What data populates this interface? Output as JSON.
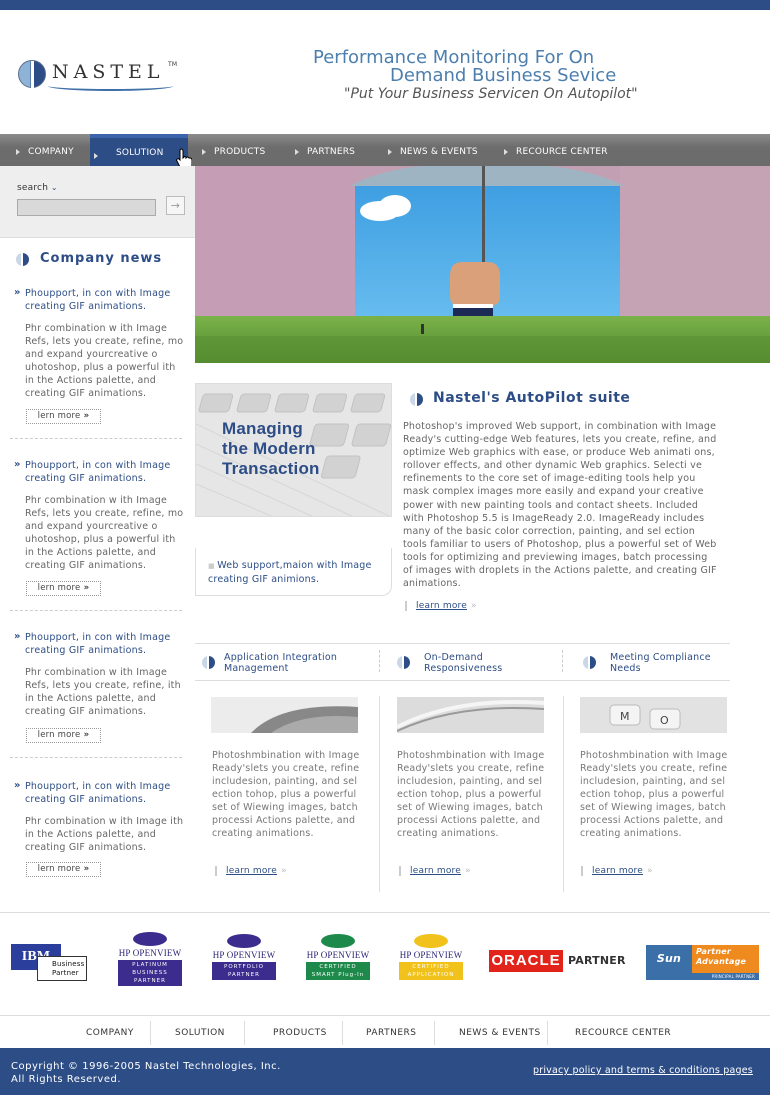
{
  "header": {
    "logo_text": "NASTEL",
    "logo_tm": "TM",
    "tagline_line1": "Performance Monitoring For  On",
    "tagline_line2": "Demand Business Sevice",
    "tagline_quote": "\"Put Your Business Servicen On Autopilot\""
  },
  "nav": {
    "items": [
      {
        "label": "COMPANY"
      },
      {
        "label": "SOLUTION"
      },
      {
        "label": "PRODUCTS"
      },
      {
        "label": "PARTNERS"
      },
      {
        "label": "NEWS & EVENTS"
      },
      {
        "label": "RECOURCE CENTER"
      }
    ],
    "active": "SOLUTION"
  },
  "search": {
    "label": "search",
    "placeholder": "",
    "go_icon": "arrow-right-icon"
  },
  "company_news": {
    "title": "Company news",
    "items": [
      {
        "headline": "Phoupport, in con with Image creating GIF animations.",
        "body": "Phr combination w ith Image Refs, lets you create, refine, mo and expand yourcreative o uhotoshop, plus a powerful ith in the Actions palette, and creating GIF animations.",
        "link": "lern more"
      },
      {
        "headline": "Phoupport, in con with Image creating GIF animations.",
        "body": "Phr combination w ith Image Refs, lets you create, refine, mo and expand yourcreative o uhotoshop, plus a powerful ith in the Actions palette, and creating GIF animations.",
        "link": "lern more"
      },
      {
        "headline": "Phoupport, in con with Image creating GIF animations.",
        "body": "Phr combination w ith Image Refs, lets you create, refine, ith in the Actions palette, and creating GIF animations.",
        "link": "lern more"
      },
      {
        "headline": "Phoupport, in con with Image creating GIF animations.",
        "body": "Phr combination w ith Image ith in the Actions palette, and creating GIF animations.",
        "link": "lern more"
      }
    ]
  },
  "feature": {
    "image_title_line1": "Managing",
    "image_title_line2": "the Modern",
    "image_title_line3": "Transaction",
    "callout": "Web support,maion with Image creating GIF animions."
  },
  "suite": {
    "title": "Nastel's AutoPilot suite",
    "body": "Photoshop's improved Web support, in combination with Image Ready's cutting-edge Web features, lets you create, refine, and optimize Web graphics with ease, or produce Web animati ons, rollover effects, and other dynamic Web graphics. Selecti ve refinements to the core set of image-editing tools help you mask complex images more easily and expand your creative power with new painting tools and contact sheets. Included with Photoshop 5.5 is ImageReady 2.0. ImageReady includes many of the basic color correction, painting, and sel ection tools familiar to users of Photoshop, plus a powerful set of Web tools for optimizing and previewing images, batch processing of images with droplets in the Actions palette, and creating GIF animations.",
    "link": "learn more"
  },
  "columns": [
    {
      "title_line1": "Application Integration",
      "title_line2": "Management",
      "body": "Photoshmbination with Image Ready'slets you create, refine includesion, painting, and sel ection tohop, plus a powerful set of Wiewing images, batch processi Actions palette, and creating animations.",
      "link": "learn more"
    },
    {
      "title_line1": "On-Demand",
      "title_line2": "Responsiveness",
      "body": "Photoshmbination with Image Ready'slets you create, refine includesion, painting, and sel ection tohop, plus a powerful set of Wiewing images, batch processi Actions palette, and creating animations.",
      "link": "learn more"
    },
    {
      "title_line1": "Meeting Compliance",
      "title_line2": "Needs",
      "body": "Photoshmbination with Image Ready'slets you create, refine includesion, painting, and sel ection tohop, plus a powerful set of Wiewing images, batch processi Actions palette, and creating animations.",
      "link": "learn more"
    }
  ],
  "partners": [
    {
      "name": "IBM",
      "sub": "Business Partner"
    },
    {
      "name": "HP OPENVIEW",
      "sub": "PLATINUM BUSINESS PARTNER"
    },
    {
      "name": "HP OPENVIEW",
      "sub": "PORTFOLIO PARTNER"
    },
    {
      "name": "HP OPENVIEW",
      "sub": "CERTIFIED SMART Plug-In"
    },
    {
      "name": "HP OPENVIEW",
      "sub": "CERTIFIED APPLICATION"
    },
    {
      "name": "ORACLE",
      "sub": "PARTNER"
    },
    {
      "name": "Sun",
      "sub": "Partner Advantage",
      "tag": "PRINCIPAL PARTNER"
    }
  ],
  "footer_nav": [
    {
      "label": "COMPANY"
    },
    {
      "label": "SOLUTION"
    },
    {
      "label": "PRODUCTS"
    },
    {
      "label": "PARTNERS"
    },
    {
      "label": "NEWS & EVENTS"
    },
    {
      "label": "RECOURCE CENTER"
    }
  ],
  "footer": {
    "copyright_line1": "Copyright © 1996-2005 Nastel Technologies, Inc.",
    "copyright_line2": "All Rights Reserved.",
    "privacy": "privacy policy and terms & conditions pages"
  },
  "colors": {
    "brand_blue": "#2d4d86",
    "nav_gray": "#6d6d6d",
    "link_blue": "#2d4d86"
  }
}
